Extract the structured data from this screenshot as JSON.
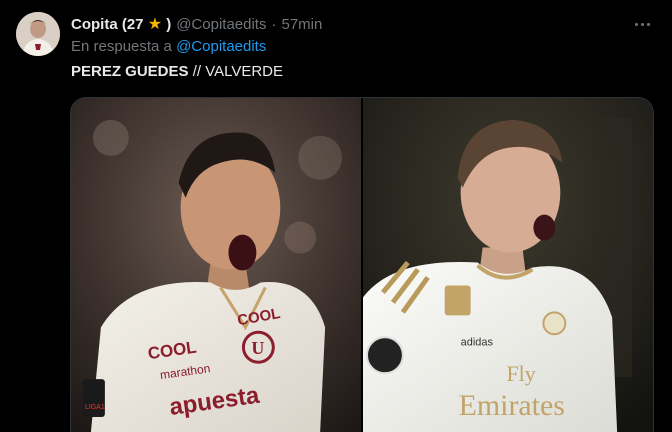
{
  "author": {
    "display_name": "Copita (27",
    "badge_icon": "star-icon",
    "badge_glyph": "★",
    "name_close": ")",
    "handle": "@Copitaedits",
    "separator": "·",
    "time": "57min"
  },
  "reply": {
    "prefix": "En respuesta a",
    "mention": "@Copitaedits"
  },
  "text": {
    "bold_part": "PEREZ GUEDES",
    "rest": " // VALVERDE"
  },
  "media": {
    "left_jersey": {
      "sponsor_top": "COOL",
      "sponsor_top_right": "COOL",
      "brand": "marathon",
      "main_sponsor": "apuesta",
      "crest": "U",
      "sleeve": "LIGA1"
    },
    "right_jersey": {
      "sponsor_line1": "Fly",
      "sponsor_line2": "Emirates",
      "brand": "adidas"
    }
  },
  "colors": {
    "background": "#000000",
    "text": "#e7e9ea",
    "muted": "#71767b",
    "link": "#1d9bf0",
    "star": "#f4b400",
    "maroon": "#8b1d2c"
  }
}
